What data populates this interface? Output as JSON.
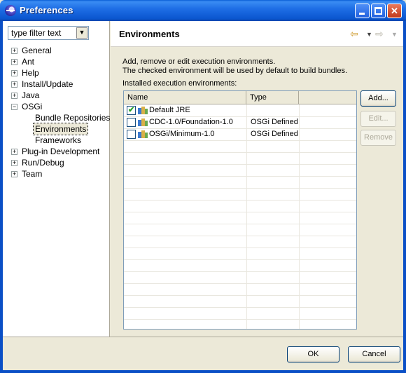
{
  "window": {
    "title": "Preferences"
  },
  "sidebar": {
    "filter_placeholder": "type filter text",
    "items": [
      {
        "label": "General",
        "depth": 0,
        "expander": "+"
      },
      {
        "label": "Ant",
        "depth": 0,
        "expander": "+"
      },
      {
        "label": "Help",
        "depth": 0,
        "expander": "+"
      },
      {
        "label": "Install/Update",
        "depth": 0,
        "expander": "+"
      },
      {
        "label": "Java",
        "depth": 0,
        "expander": "+"
      },
      {
        "label": "OSGi",
        "depth": 0,
        "expander": "−"
      },
      {
        "label": "Bundle Repositories",
        "depth": 1
      },
      {
        "label": "Environments",
        "depth": 1,
        "selected": true
      },
      {
        "label": "Frameworks",
        "depth": 1
      },
      {
        "label": "Plug-in Development",
        "depth": 0,
        "expander": "+"
      },
      {
        "label": "Run/Debug",
        "depth": 0,
        "expander": "+"
      },
      {
        "label": "Team",
        "depth": 0,
        "expander": "+"
      }
    ]
  },
  "page": {
    "title": "Environments",
    "description_line1": "Add, remove or edit execution environments.",
    "description_line2": "The checked environment will be used by default to build bundles.",
    "installed_label": "Installed execution environments:"
  },
  "table": {
    "columns": [
      "Name",
      "Type",
      ""
    ],
    "rows": [
      {
        "name": "Default JRE",
        "type": "",
        "checked": true
      },
      {
        "name": "CDC-1.0/Foundation-1.0",
        "type": "OSGi Defined",
        "checked": false
      },
      {
        "name": "OSGi/Minimum-1.0",
        "type": "OSGi Defined",
        "checked": false
      }
    ]
  },
  "buttons": {
    "add": "Add...",
    "edit": "Edit...",
    "remove": "Remove",
    "ok": "OK",
    "cancel": "Cancel"
  },
  "icons": {
    "app": "eclipse-icon",
    "back": "back-arrow-icon",
    "forward": "forward-arrow-icon",
    "environment": "environment-icon"
  },
  "colors": {
    "titlebar": "#0b56cf",
    "dialog_bg": "#ece9d8",
    "check": "#21a121"
  }
}
